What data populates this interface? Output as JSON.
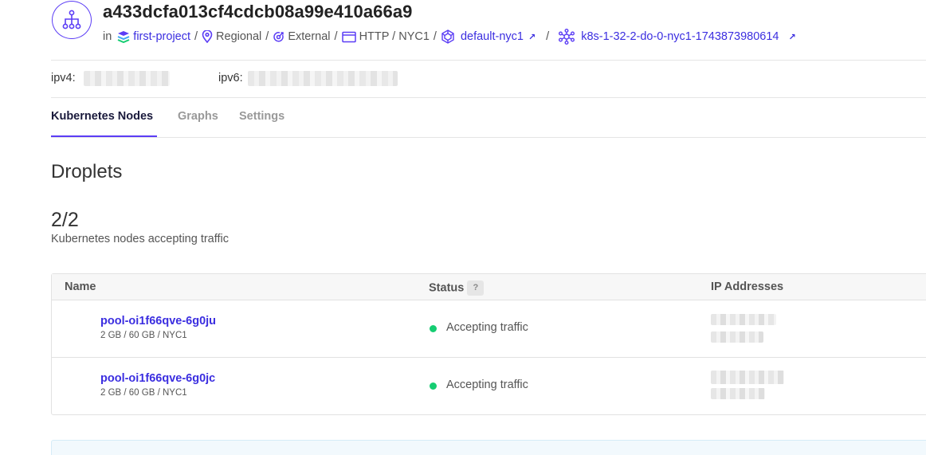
{
  "header": {
    "title": "a433dcfa013cf4cdcb08a99e410a66a9",
    "in_label": "in",
    "project": "first-project",
    "region_type": "Regional",
    "network": "External",
    "protocol_region": "HTTP / NYC1",
    "vpc": "default-nyc1",
    "cluster": "k8s-1-32-2-do-0-nyc1-1743873980614",
    "separator": "/",
    "link_color": "#3b2ee0"
  },
  "ips": {
    "ipv4_label": "ipv4:",
    "ipv6_label": "ipv6:"
  },
  "tabs": [
    {
      "label": "Kubernetes Nodes",
      "active": true
    },
    {
      "label": "Graphs",
      "active": false
    },
    {
      "label": "Settings",
      "active": false
    }
  ],
  "droplets": {
    "section_title": "Droplets",
    "count": "2/2",
    "count_label": "Kubernetes nodes accepting traffic"
  },
  "table": {
    "columns": [
      "Name",
      "Status",
      "IP Addresses"
    ],
    "status_help": "?",
    "rows": [
      {
        "name": "pool-oi1f66qve-6g0ju",
        "spec": "2 GB / 60 GB / NYC1",
        "status": "Accepting traffic",
        "status_color": "#15cd72"
      },
      {
        "name": "pool-oi1f66qve-6g0jc",
        "spec": "2 GB / 60 GB / NYC1",
        "status": "Accepting traffic",
        "status_color": "#15cd72"
      }
    ]
  },
  "icons": [
    "load-balancer-icon",
    "project-icon",
    "location-pin-icon",
    "external-icon",
    "protocol-icon",
    "vpc-icon",
    "external-link-icon",
    "kubernetes-icon"
  ]
}
